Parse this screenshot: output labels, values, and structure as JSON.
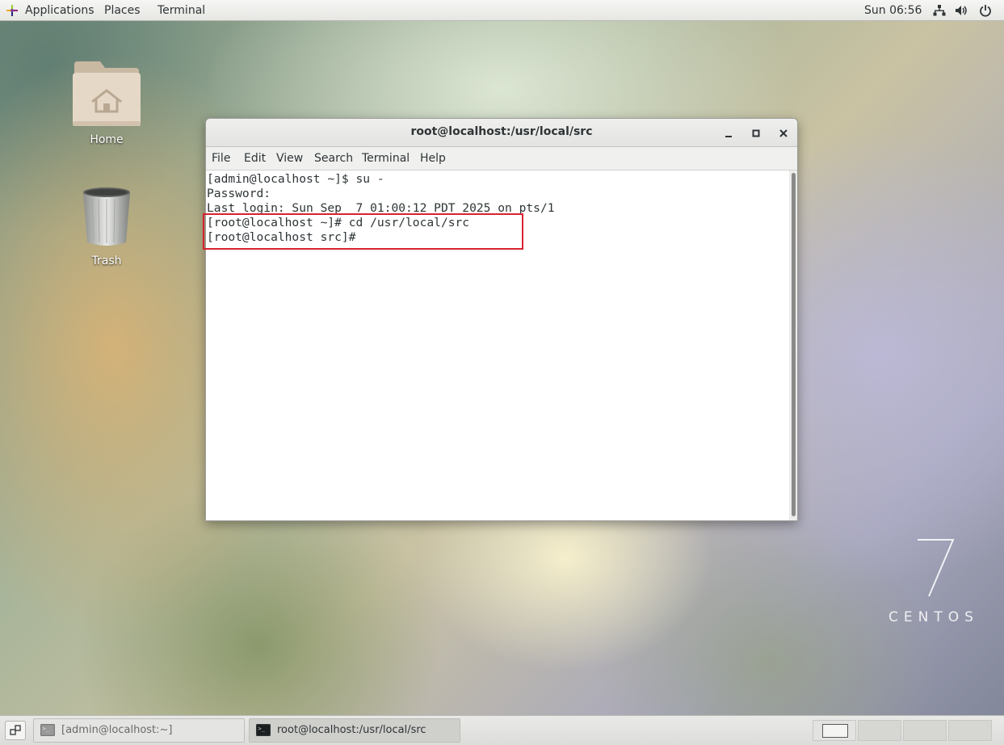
{
  "top_bar": {
    "applications": "Applications",
    "places": "Places",
    "terminal": "Terminal",
    "clock": "Sun 06:56",
    "tray_icons": [
      "network-icon",
      "volume-icon",
      "power-icon"
    ]
  },
  "desktop": {
    "icons": [
      {
        "label": "Home",
        "icon": "home-folder-icon"
      },
      {
        "label": "Trash",
        "icon": "trash-icon"
      }
    ],
    "watermark": {
      "version": "7",
      "brand": "CENTOS"
    }
  },
  "window": {
    "title": "root@localhost:/usr/local/src",
    "menu": [
      "File",
      "Edit",
      "View",
      "Search",
      "Terminal",
      "Help"
    ],
    "controls": [
      "minimize-icon",
      "maximize-icon",
      "close-icon"
    ],
    "terminal_lines": [
      "[admin@localhost ~]$ su -",
      "Password:",
      "Last login: Sun Sep  7 01:00:12 PDT 2025 on pts/1",
      "[root@localhost ~]# cd /usr/local/src",
      "[root@localhost src]#"
    ],
    "highlight_color": "#d8232f"
  },
  "taskbar": {
    "items": [
      {
        "label": "[admin@localhost:~]",
        "active": false
      },
      {
        "label": "root@localhost:/usr/local/src",
        "active": true
      }
    ],
    "workspaces": 4,
    "active_workspace": 1
  }
}
